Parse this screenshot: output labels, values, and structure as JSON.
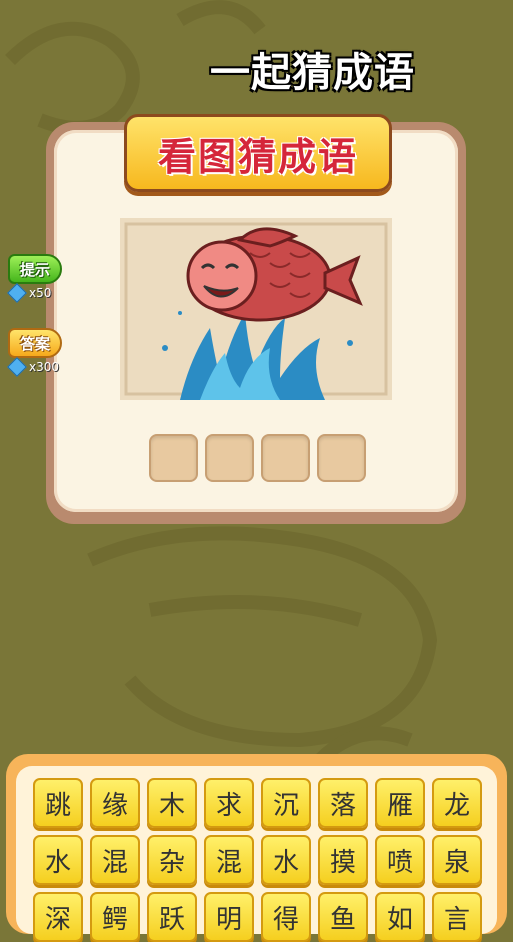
{
  "header": {
    "title": "一起猜成语"
  },
  "card": {
    "banner_title": "看图猜成语"
  },
  "answer": {
    "slots": [
      "",
      "",
      "",
      ""
    ]
  },
  "sidebar": {
    "hint": {
      "label": "提示",
      "cost": "x50"
    },
    "reveal": {
      "label": "答案",
      "cost": "x300"
    }
  },
  "board": {
    "rows": [
      [
        "跳",
        "缘",
        "木",
        "求",
        "沉",
        "落",
        "雁",
        "龙"
      ],
      [
        "水",
        "混",
        "杂",
        "混",
        "水",
        "摸",
        "喷",
        "泉"
      ],
      [
        "深",
        "鳄",
        "跃",
        "明",
        "得",
        "鱼",
        "如",
        "言"
      ]
    ]
  },
  "colors": {
    "background": "#7a7638",
    "banner_text": "#d5263a",
    "tile": "#f5cf1f"
  },
  "icons": {
    "gem": "gem-icon"
  }
}
